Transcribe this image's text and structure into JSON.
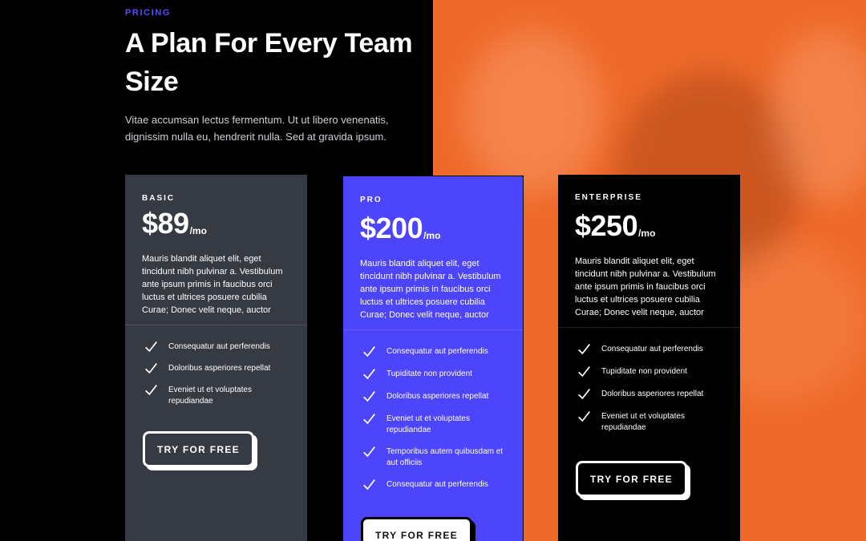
{
  "hero": {
    "eyebrow": "PRICING",
    "title": "A Plan For Every Team Size",
    "description": "Vitae accumsan lectus fermentum. Ut ut libero venenatis, dignissim nulla eu, hendrerit nulla. Sed at gravida ipsum."
  },
  "colors": {
    "accent": "#5b4cff",
    "orange": "#ef6a2a",
    "basic_card": "#363a43",
    "pro_card": "#4c45fb",
    "enterprise_card": "#000000"
  },
  "plans": [
    {
      "name": "BASIC",
      "price": "$89",
      "period": "/mo",
      "description": "Mauris blandit aliquet elit, eget tincidunt nibh pulvinar a. Vestibulum ante ipsum primis in faucibus orci luctus et ultrices posuere cubilia Curae; Donec velit neque, auctor",
      "features": [
        "Consequatur aut perferendis",
        "Doloribus asperiores repellat",
        "Eveniet ut et voluptates repudiandae"
      ],
      "cta": "TRY FOR FREE",
      "check_icon": "check-icon"
    },
    {
      "name": "PRO",
      "price": "$200",
      "period": "/mo",
      "description": "Mauris blandit aliquet elit, eget tincidunt nibh pulvinar a. Vestibulum ante ipsum primis in faucibus orci luctus et ultrices posuere cubilia Curae; Donec velit neque, auctor",
      "features": [
        "Consequatur aut perferendis",
        "Tupiditate non provident",
        "Doloribus asperiores repellat",
        "Eveniet ut et voluptates repudiandae",
        "Temporibus autem quibusdam et aut officiis",
        "Consequatur aut perferendis"
      ],
      "cta": "TRY FOR FREE",
      "check_icon": "check-icon"
    },
    {
      "name": "ENTERPRISE",
      "price": "$250",
      "period": "/mo",
      "description": "Mauris blandit aliquet elit, eget tincidunt nibh pulvinar a. Vestibulum ante ipsum primis in faucibus orci luctus et ultrices posuere cubilia Curae; Donec velit neque, auctor",
      "features": [
        "Consequatur aut perferendis",
        "Tupiditate non provident",
        "Doloribus asperiores repellat",
        "Eveniet ut et voluptates repudiandae"
      ],
      "cta": "TRY FOR FREE",
      "check_icon": "check-icon"
    }
  ]
}
